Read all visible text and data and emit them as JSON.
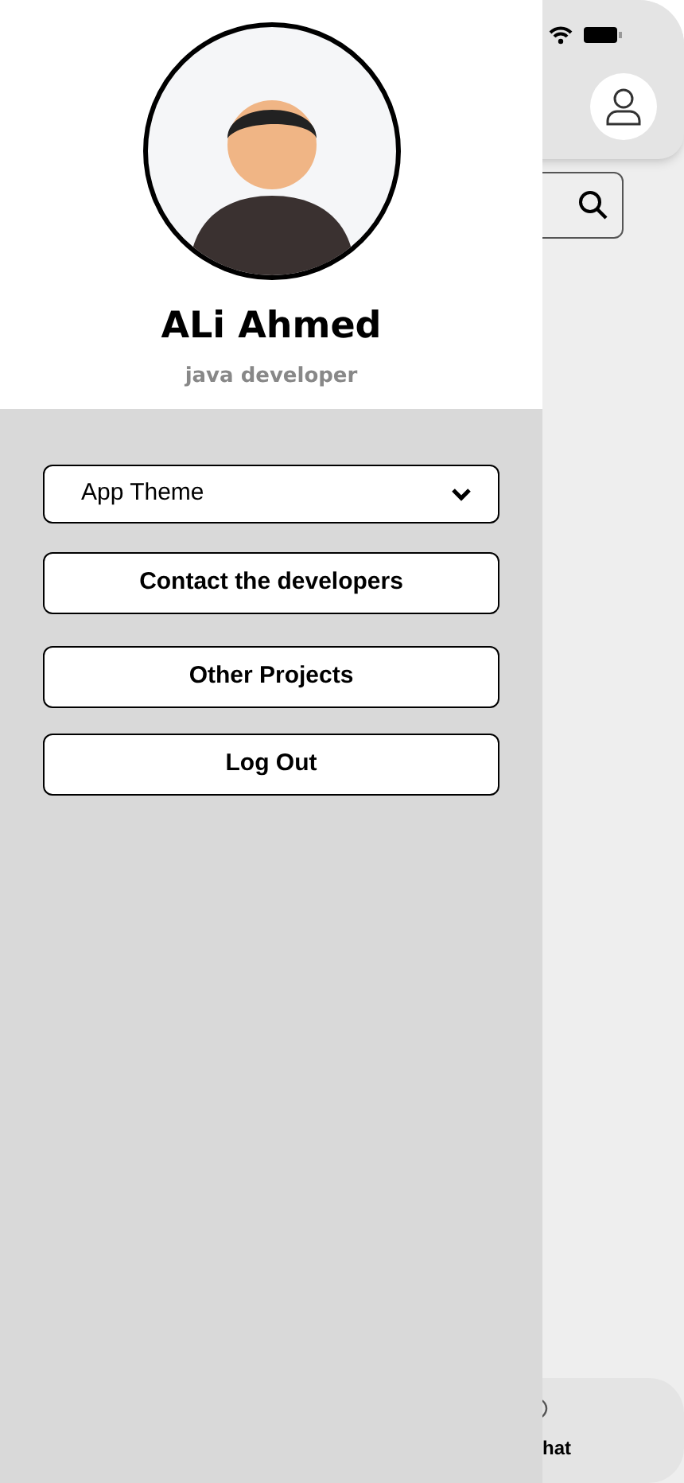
{
  "profile": {
    "name": "ALi Ahmed",
    "role": "java developer"
  },
  "drawer_items": [
    {
      "kind": "dropdown",
      "label": "App Theme"
    },
    {
      "kind": "button",
      "label": "Contact the developers"
    },
    {
      "kind": "button",
      "label": "Other Projects"
    },
    {
      "kind": "button",
      "label": "Log Out"
    }
  ],
  "bottom_nav": {
    "label": "hat"
  }
}
